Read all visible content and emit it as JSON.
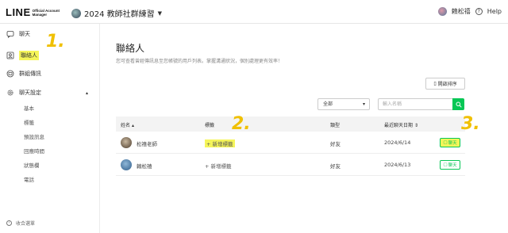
{
  "topbar": {
    "logo_main": "LINE",
    "logo_sub_1": "Official Account",
    "logo_sub_2": "Manager",
    "account_name": "2024 教師社群練習",
    "user_name": "賴松禧",
    "help_label": "Help"
  },
  "sidebar": {
    "items": [
      {
        "label": "聊天",
        "icon": "chat-icon"
      },
      {
        "label": "聯絡人",
        "icon": "contacts-icon"
      },
      {
        "label": "群組傳訊",
        "icon": "broadcast-icon"
      },
      {
        "label": "聊天設定",
        "icon": "gear-icon"
      }
    ],
    "sub_items": [
      "基本",
      "標籤",
      "預設訊息",
      "回應時間",
      "狀態欄",
      "電話"
    ],
    "collapse_label": "收合選單"
  },
  "main": {
    "title": "聯絡人",
    "description": "您可查看曾經傳訊息至您帳號的用戶列表。掌握溝通狀況，個別處理更有效率！",
    "sort_button": "開啟排序",
    "filter_value": "全部",
    "search_placeholder": "輸入名稱",
    "columns": [
      "姓名",
      "標籤",
      "類型",
      "最近聊天日期"
    ],
    "rows": [
      {
        "name": "松禧老師",
        "tag": "+ 新增標籤",
        "type": "好友",
        "date": "2024/6/14",
        "chat": "聊天"
      },
      {
        "name": "賴松禧",
        "tag": "+ 新增標籤",
        "type": "好友",
        "date": "2024/6/13",
        "chat": "聊天"
      }
    ]
  },
  "annotations": [
    "1.",
    "2.",
    "3."
  ],
  "colors": {
    "accent": "#06c755",
    "highlight": "#f5f55a",
    "annotation": "#f0c000"
  }
}
